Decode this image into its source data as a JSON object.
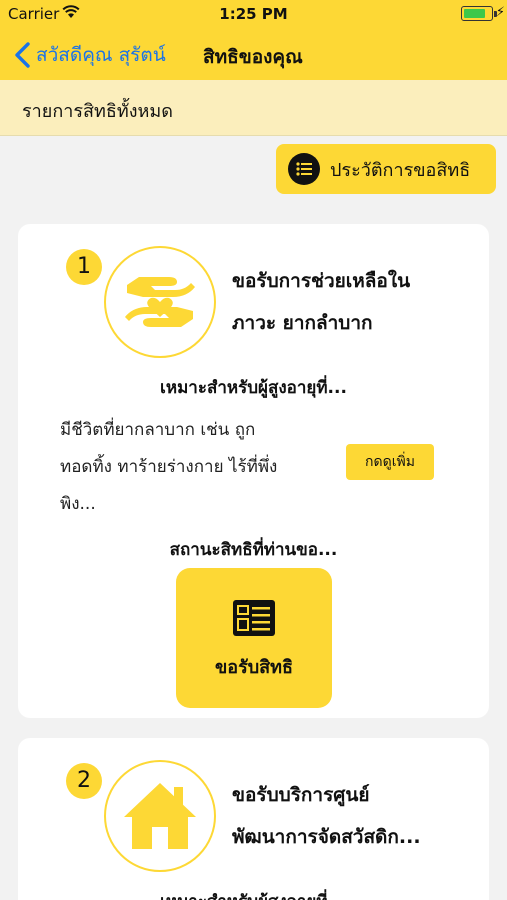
{
  "status_bar": {
    "carrier": "Carrier",
    "time": "1:25 PM",
    "battery_level": 0.85
  },
  "nav": {
    "back_label": "สวัสดีคุณ สุรัตน์",
    "title": "สิทธิของคุณ"
  },
  "section": {
    "title": "รายการสิทธิทั้งหมด"
  },
  "history_button": {
    "label": "ประวัติการขอสิทธิ",
    "icon": "list-icon"
  },
  "cards": [
    {
      "number": "1",
      "icon": "helping-hands-heart-icon",
      "title_line1": "ขอรับการช่วยเหลือใน",
      "title_line2": "ภาวะ ยากลำบาก",
      "suitable_label": "เหมาะสำหรับผู้สูงอายุที่...",
      "desc_line1": "มีชีวิตที่ยากลาบาก เช่น ถูก",
      "desc_line2": "ทอดทิ้ง ทาร้ายร่างกาย ไร้ที่พึ่ง",
      "desc_line3": "พิง...",
      "more_label": "กดดูเพิ่ม",
      "status_label": "สถานะสิทธิที่ท่านขอ...",
      "claim_label": "ขอรับสิทธิ",
      "claim_icon": "document-icon"
    },
    {
      "number": "2",
      "icon": "house-icon",
      "title_line1": "ขอรับบริการศูนย์",
      "title_line2": "พัฒนาการจัดสวัสดิก...",
      "suitable_label": "เหมาะสำหรับผู้สูงอายุที่..."
    }
  ],
  "colors": {
    "accent": "#fdd835",
    "back_link": "#1a73e8",
    "header_bg": "#fbeebc",
    "page_bg": "#f2f2f2"
  }
}
